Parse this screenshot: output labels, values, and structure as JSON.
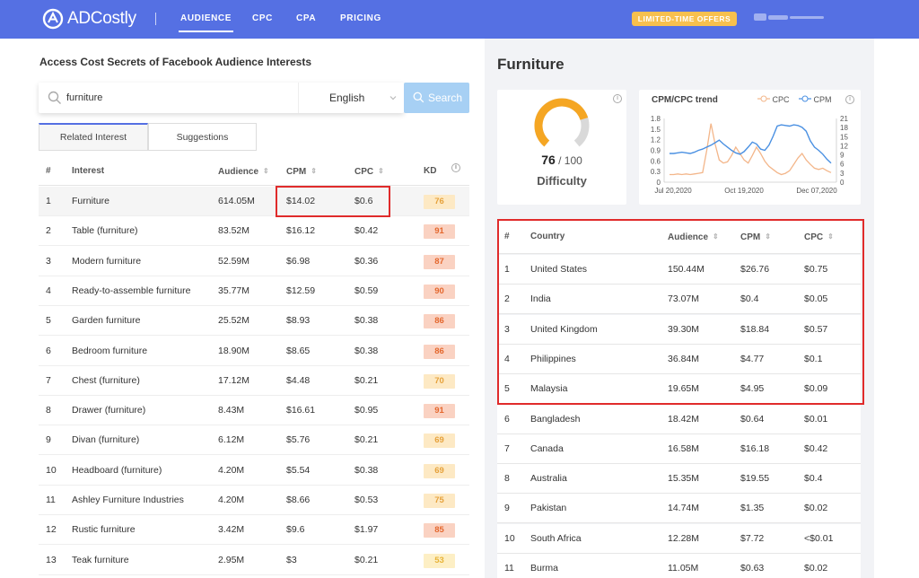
{
  "nav": {
    "logo_text": "ADCostly",
    "items": [
      {
        "label": "AUDIENCE",
        "active": true
      },
      {
        "label": "CPC",
        "active": false
      },
      {
        "label": "CPA",
        "active": false
      },
      {
        "label": "PRICING",
        "active": false
      }
    ],
    "offer_label": "LIMITED-TIME OFFERS"
  },
  "left": {
    "title": "Access Cost Secrets of Facebook Audience Interests",
    "search": {
      "value": "furniture",
      "language": "English",
      "button_label": "Search"
    },
    "tabs": [
      {
        "label": "Related Interest",
        "active": true
      },
      {
        "label": "Suggestions",
        "active": false
      }
    ],
    "columns": {
      "num": "#",
      "interest": "Interest",
      "audience": "Audience",
      "cpm": "CPM",
      "cpc": "CPC",
      "kd": "KD"
    },
    "rows": [
      {
        "num": "1",
        "interest": "Furniture",
        "audience": "614.05M",
        "cpm": "$14.02",
        "cpc": "$0.6",
        "kd": "76"
      },
      {
        "num": "2",
        "interest": "Table (furniture)",
        "audience": "83.52M",
        "cpm": "$16.12",
        "cpc": "$0.42",
        "kd": "91"
      },
      {
        "num": "3",
        "interest": "Modern furniture",
        "audience": "52.59M",
        "cpm": "$6.98",
        "cpc": "$0.36",
        "kd": "87"
      },
      {
        "num": "4",
        "interest": "Ready-to-assemble furniture",
        "audience": "35.77M",
        "cpm": "$12.59",
        "cpc": "$0.59",
        "kd": "90"
      },
      {
        "num": "5",
        "interest": "Garden furniture",
        "audience": "25.52M",
        "cpm": "$8.93",
        "cpc": "$0.38",
        "kd": "86"
      },
      {
        "num": "6",
        "interest": "Bedroom furniture",
        "audience": "18.90M",
        "cpm": "$8.65",
        "cpc": "$0.38",
        "kd": "86"
      },
      {
        "num": "7",
        "interest": "Chest (furniture)",
        "audience": "17.12M",
        "cpm": "$4.48",
        "cpc": "$0.21",
        "kd": "70"
      },
      {
        "num": "8",
        "interest": "Drawer (furniture)",
        "audience": "8.43M",
        "cpm": "$16.61",
        "cpc": "$0.95",
        "kd": "91"
      },
      {
        "num": "9",
        "interest": "Divan (furniture)",
        "audience": "6.12M",
        "cpm": "$5.76",
        "cpc": "$0.21",
        "kd": "69"
      },
      {
        "num": "10",
        "interest": "Headboard (furniture)",
        "audience": "4.20M",
        "cpm": "$5.54",
        "cpc": "$0.38",
        "kd": "69"
      },
      {
        "num": "11",
        "interest": "Ashley Furniture Industries",
        "audience": "4.20M",
        "cpm": "$8.66",
        "cpc": "$0.53",
        "kd": "75"
      },
      {
        "num": "12",
        "interest": "Rustic furniture",
        "audience": "3.42M",
        "cpm": "$9.6",
        "cpc": "$1.97",
        "kd": "85"
      },
      {
        "num": "13",
        "interest": "Teak furniture",
        "audience": "2.95M",
        "cpm": "$3",
        "cpc": "$0.21",
        "kd": "53"
      }
    ]
  },
  "right": {
    "title": "Furniture",
    "difficulty": {
      "score": "76",
      "max": "/ 100",
      "label": "Difficulty",
      "fraction": 0.76
    },
    "trend": {
      "title": "CPM/CPC trend",
      "legend_cpc": "CPC",
      "legend_cpm": "CPM",
      "left_ticks": [
        "1.8",
        "1.5",
        "1.2",
        "0.9",
        "0.6",
        "0.3",
        "0"
      ],
      "right_ticks": [
        "21",
        "18",
        "15",
        "12",
        "9",
        "6",
        "3",
        "0"
      ],
      "x_ticks": [
        "Jul 20,2020",
        "Oct 19,2020",
        "Dec 07,2020"
      ],
      "colors": {
        "cpc": "#f3b68a",
        "cpm": "#4a90e2"
      }
    },
    "columns": {
      "num": "#",
      "country": "Country",
      "audience": "Audience",
      "cpm": "CPM",
      "cpc": "CPC"
    },
    "rows": [
      {
        "num": "1",
        "country": "United States",
        "audience": "150.44M",
        "cpm": "$26.76",
        "cpc": "$0.75"
      },
      {
        "num": "2",
        "country": "India",
        "audience": "73.07M",
        "cpm": "$0.4",
        "cpc": "$0.05"
      },
      {
        "num": "3",
        "country": "United Kingdom",
        "audience": "39.30M",
        "cpm": "$18.84",
        "cpc": "$0.57"
      },
      {
        "num": "4",
        "country": "Philippines",
        "audience": "36.84M",
        "cpm": "$4.77",
        "cpc": "$0.1"
      },
      {
        "num": "5",
        "country": "Malaysia",
        "audience": "19.65M",
        "cpm": "$4.95",
        "cpc": "$0.09"
      },
      {
        "num": "6",
        "country": "Bangladesh",
        "audience": "18.42M",
        "cpm": "$0.64",
        "cpc": "$0.01"
      },
      {
        "num": "7",
        "country": "Canada",
        "audience": "16.58M",
        "cpm": "$16.18",
        "cpc": "$0.42"
      },
      {
        "num": "8",
        "country": "Australia",
        "audience": "15.35M",
        "cpm": "$19.55",
        "cpc": "$0.4"
      },
      {
        "num": "9",
        "country": "Pakistan",
        "audience": "14.74M",
        "cpm": "$1.35",
        "cpc": "$0.02"
      },
      {
        "num": "10",
        "country": "South Africa",
        "audience": "12.28M",
        "cpm": "$7.72",
        "cpc": "<$0.01"
      },
      {
        "num": "11",
        "country": "Burma",
        "audience": "11.05M",
        "cpm": "$0.63",
        "cpc": "$0.02"
      }
    ]
  },
  "colors": {
    "nav_bg": "#5570e3",
    "accent": "#5570e3",
    "gauge": "#f5a623",
    "highlight_box": "#e02b2b"
  }
}
